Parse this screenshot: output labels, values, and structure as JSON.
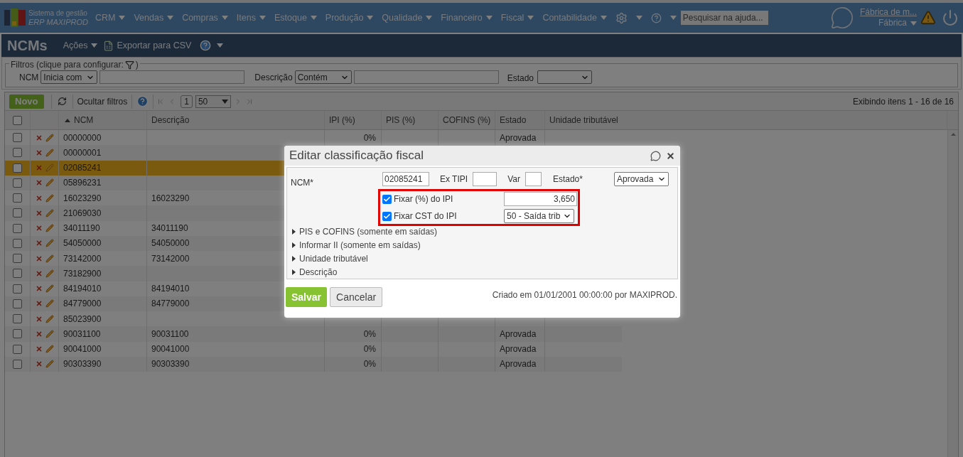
{
  "brand": {
    "line1": "Sistema de gestão",
    "line2": "ERP MAXIPROD"
  },
  "menu": [
    {
      "label": "CRM"
    },
    {
      "label": "Vendas"
    },
    {
      "label": "Compras"
    },
    {
      "label": "Itens"
    },
    {
      "label": "Estoque"
    },
    {
      "label": "Produção"
    },
    {
      "label": "Qualidade"
    },
    {
      "label": "Financeiro"
    },
    {
      "label": "Fiscal"
    },
    {
      "label": "Contabilidade"
    }
  ],
  "help_search": {
    "placeholder": "Pesquisar na ajuda..."
  },
  "user": {
    "company": "Fábrica de m...",
    "role": "Fábrica"
  },
  "page": {
    "title": "NCMs",
    "actions": "Ações",
    "export": "Exportar para CSV"
  },
  "filters": {
    "legend": "Filtros (clique para configurar:",
    "legend_end": ")",
    "fields": [
      {
        "label": "NCM",
        "operator": "Inicia com"
      },
      {
        "label": "Descrição",
        "operator": "Contém"
      }
    ],
    "estado_label": "Estado"
  },
  "toolbar": {
    "new": "Novo",
    "hide_filters": "Ocultar filtros",
    "page": "1",
    "page_size": "50",
    "summary": "Exibindo itens 1 - 16 de 16"
  },
  "table": {
    "select_all_checked": false,
    "columns": [
      "NCM",
      "Descrição",
      "IPI (%)",
      "PIS (%)",
      "COFINS (%)",
      "Estado",
      "Unidade tributável"
    ],
    "rows": [
      {
        "ncm": "00000000",
        "description": "",
        "ipi": "0%",
        "estado": "Aprovada",
        "checked": false,
        "selected": false
      },
      {
        "ncm": "00000001",
        "description": "",
        "checked": false,
        "selected": false
      },
      {
        "ncm": "02085241",
        "description": "",
        "checked": false,
        "selected": true
      },
      {
        "ncm": "05896231",
        "description": "",
        "checked": false,
        "selected": false
      },
      {
        "ncm": "16023290",
        "description": "16023290",
        "checked": false,
        "selected": false
      },
      {
        "ncm": "21069030",
        "description": "",
        "checked": false,
        "selected": false
      },
      {
        "ncm": "34011190",
        "description": "34011190",
        "checked": false,
        "selected": false
      },
      {
        "ncm": "54050000",
        "description": "54050000",
        "checked": false,
        "selected": false
      },
      {
        "ncm": "73142000",
        "description": "73142000",
        "checked": false,
        "selected": false
      },
      {
        "ncm": "73182900",
        "description": "",
        "checked": false,
        "selected": false
      },
      {
        "ncm": "84194010",
        "description": "84194010",
        "checked": false,
        "selected": false
      },
      {
        "ncm": "84779000",
        "description": "84779000",
        "checked": false,
        "selected": false
      },
      {
        "ncm": "85023900",
        "description": "",
        "checked": false,
        "selected": false
      },
      {
        "ncm": "90031100",
        "description": "90031100",
        "ipi": "0%",
        "estado": "Aprovada",
        "checked": false,
        "selected": false
      },
      {
        "ncm": "90041000",
        "description": "90041000",
        "ipi": "0%",
        "estado": "Aprovada",
        "checked": false,
        "selected": false
      },
      {
        "ncm": "90303390",
        "description": "90303390",
        "ipi": "0%",
        "estado": "Aprovada",
        "checked": false,
        "selected": false
      }
    ]
  },
  "dialog": {
    "title": "Editar classificação fiscal",
    "ncm_label": "NCM*",
    "ncm_value": "02085241",
    "ex_tipi_label": "Ex TIPI",
    "var_label": "Var",
    "estado_label": "Estado*",
    "estado_value": "Aprovada",
    "options": [
      {
        "label": "Fixar (%) do IPI",
        "checked": true,
        "kind": "text",
        "value": "3,650"
      },
      {
        "label": "Fixar CST do IPI",
        "checked": true,
        "kind": "select",
        "value": "50 - Saída trib"
      }
    ],
    "sections": [
      {
        "label": "PIS e COFINS (somente em saídas)",
        "expanded": false
      },
      {
        "label": "Informar II (somente em saídas)",
        "expanded": false
      },
      {
        "label": "Unidade tributável",
        "expanded": false
      },
      {
        "label": "Descrição",
        "expanded": false
      }
    ],
    "save": "Salvar",
    "cancel": "Cancelar",
    "created": "Criado em 01/01/2001 00:00:00 por MAXIPROD."
  }
}
